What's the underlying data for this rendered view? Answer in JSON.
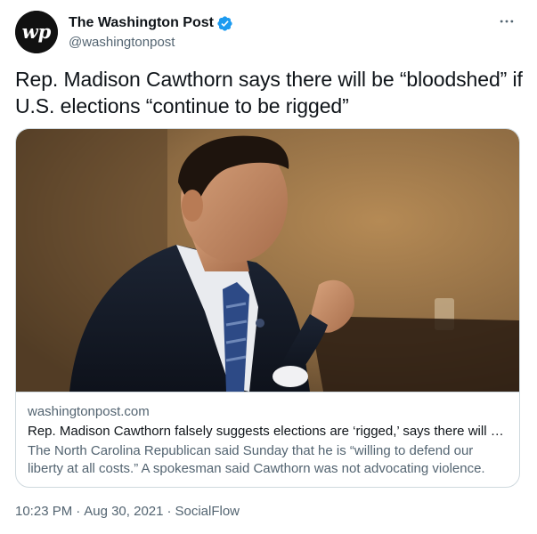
{
  "account": {
    "display_name": "The Washington Post",
    "handle": "@washingtonpost",
    "verified": true,
    "avatar_icon": "washington-post-wp-logo-icon"
  },
  "tweet": {
    "text": "Rep. Madison Cawthorn says there will be “bloodshed” if U.S. elections “continue to be rigged”"
  },
  "card": {
    "domain": "washingtonpost.com",
    "title": "Rep. Madison Cawthorn falsely suggests elections are ‘rigged,’ says there will be bloodshed",
    "description": "The North Carolina Republican said Sunday that he is “willing to defend our liberty at all costs.” A spokesman said Cawthorn was not advocating violence."
  },
  "meta": {
    "time": "10:23 PM",
    "date": "Aug 30, 2021",
    "source": "SocialFlow",
    "separator": "·"
  },
  "colors": {
    "text_primary": "#0f1419",
    "text_secondary": "#536471",
    "verified_blue": "#1d9bf0",
    "border": "#cfd9de"
  }
}
